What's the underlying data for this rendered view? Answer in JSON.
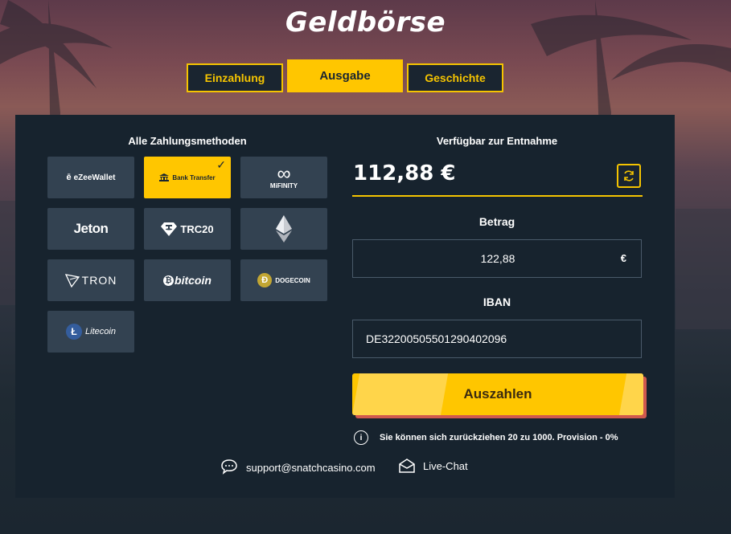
{
  "title": "Geldbörse",
  "tabs": [
    {
      "label": "Einzahlung"
    },
    {
      "label": "Ausgabe"
    },
    {
      "label": "Geschichte"
    }
  ],
  "methods_title": "Alle Zahlungsmethoden",
  "methods": [
    {
      "label": "eZeeWallet",
      "icon": "ezeewallet-logo"
    },
    {
      "label": "Bank Transfer",
      "icon": "bank-icon",
      "selected": true
    },
    {
      "label": "MiFINITY",
      "icon": "mifinity-logo"
    },
    {
      "label": "Jeton",
      "icon": "jeton-logo"
    },
    {
      "label": "TRC20",
      "icon": "tether-icon"
    },
    {
      "label": "",
      "icon": "ethereum-icon"
    },
    {
      "label": "TRON",
      "icon": "tron-icon"
    },
    {
      "label": "bitcoin",
      "icon": "bitcoin-icon"
    },
    {
      "label": "DOGECOIN",
      "icon": "dogecoin-icon"
    },
    {
      "label": "Litecoin",
      "icon": "litecoin-icon"
    }
  ],
  "available": {
    "title": "Verfügbar zur Entnahme",
    "balance": "112,88 €"
  },
  "amount": {
    "label": "Betrag",
    "value": "122,88",
    "currency": "€"
  },
  "iban": {
    "label": "IBAN",
    "value": "DE32200505501290402096"
  },
  "submit_label": "Auszahlen",
  "info_text": "Sie können sich zurückziehen 20 zu 1000. Provision - 0%",
  "support_email": "support@snatchcasino.com",
  "live_chat": "Live-Chat",
  "colors": {
    "accent": "#ffc600",
    "panel": "#17232e",
    "tile": "#334251",
    "button_shadow": "#d0594e"
  }
}
